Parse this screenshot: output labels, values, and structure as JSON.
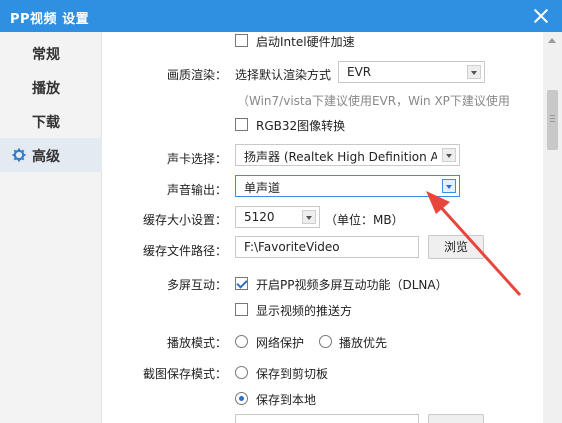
{
  "window": {
    "title": "PP视频 设置"
  },
  "sidebar": {
    "items": [
      {
        "label": "常规"
      },
      {
        "label": "播放"
      },
      {
        "label": "下载"
      },
      {
        "label": "高级",
        "active": true,
        "icon": "gear-icon"
      }
    ]
  },
  "settings": {
    "hw_accel": {
      "label": "启动Intel硬件加速",
      "checked": false
    },
    "render": {
      "label": "画质渲染：",
      "select_label": "选择默认渲染方式",
      "value": "EVR",
      "hint": "（Win7/vista下建议使用EVR，Win XP下建议使用"
    },
    "rgb32": {
      "label": "RGB32图像转换",
      "checked": false
    },
    "sound_card": {
      "label": "声卡选择：",
      "value": "扬声器 (Realtek High Definition Au"
    },
    "sound_output": {
      "label": "声音输出：",
      "value": "单声道"
    },
    "cache_size": {
      "label": "缓存大小设置：",
      "value": "5120",
      "unit": "（单位：MB）"
    },
    "cache_path": {
      "label": "缓存文件路径：",
      "value": "F:\\FavoriteVideo",
      "browse": "浏览"
    },
    "multiscreen": {
      "label": "多屏互动：",
      "dlna": {
        "label": "开启PP视频多屏互动功能（DLNA）",
        "checked": true
      },
      "push": {
        "label": "显示视频的推送方",
        "checked": false
      }
    },
    "play_mode": {
      "label": "播放模式：",
      "options": [
        {
          "label": "网络保护",
          "checked": false
        },
        {
          "label": "播放优先",
          "checked": false
        }
      ]
    },
    "screenshot_save": {
      "label": "截图保存模式：",
      "options": [
        {
          "label": "保存到剪切板",
          "checked": false
        },
        {
          "label": "保存到本地",
          "checked": true
        }
      ]
    }
  },
  "colors": {
    "titlebar": "#2f8fe0",
    "annotation_arrow": "#e8453c"
  }
}
